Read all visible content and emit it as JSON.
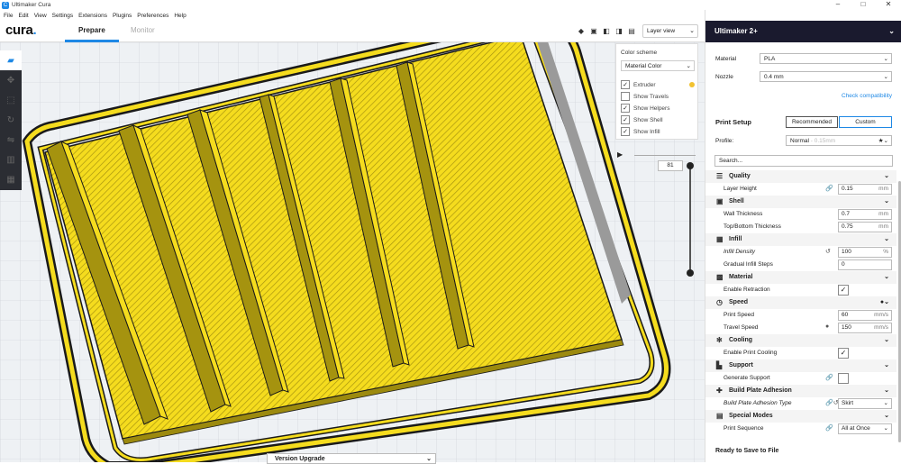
{
  "window": {
    "title": "Ultimaker Cura",
    "app_icon": "C",
    "controls": [
      "–",
      "□",
      "✕"
    ]
  },
  "menu": [
    "File",
    "Edit",
    "View",
    "Settings",
    "Extensions",
    "Plugins",
    "Preferences",
    "Help"
  ],
  "header": {
    "logo": "cura",
    "logo_dot": ".",
    "tabs": {
      "prepare": "Prepare",
      "monitor": "Monitor"
    },
    "view_mode": "Layer view",
    "view_icons": [
      "3d-view-icon",
      "front-view-icon",
      "top-view-icon",
      "left-view-icon",
      "right-view-icon"
    ]
  },
  "layer_panel": {
    "color_scheme_label": "Color scheme",
    "color_scheme_value": "Material Color",
    "options": [
      {
        "label": "Extruder",
        "checked": true
      },
      {
        "label": "Show Travels",
        "checked": false
      },
      {
        "label": "Show Helpers",
        "checked": true
      },
      {
        "label": "Show Shell",
        "checked": true
      },
      {
        "label": "Show Infill",
        "checked": true
      }
    ],
    "extruder_color": "#f2c230",
    "current_layer": "81"
  },
  "version_upgrade": {
    "label": "Version Upgrade"
  },
  "sidebar": {
    "printer": "Ultimaker 2+",
    "material_label": "Material",
    "material_value": "PLA",
    "nozzle_label": "Nozzle",
    "nozzle_value": "0.4 mm",
    "check_compat": "Check compatibility",
    "print_setup": "Print Setup",
    "recommended": "Recommended",
    "custom": "Custom",
    "profile_label": "Profile:",
    "profile_value": "Normal",
    "profile_suffix": " - 0.15mm",
    "search_placeholder": "Search...",
    "ready": "Ready to Save to File"
  },
  "settings": {
    "quality": {
      "label": "Quality",
      "layer_height_label": "Layer Height",
      "layer_height": "0.15",
      "layer_height_unit": "mm"
    },
    "shell": {
      "label": "Shell",
      "wall_label": "Wall Thickness",
      "wall": "0.7",
      "wall_unit": "mm",
      "tb_label": "Top/Bottom Thickness",
      "tb": "0.75",
      "tb_unit": "mm"
    },
    "infill": {
      "label": "Infill",
      "density_label": "Infill Density",
      "density": "100",
      "density_unit": "%",
      "gradual_label": "Gradual Infill Steps",
      "gradual": "0"
    },
    "material": {
      "label": "Material",
      "retraction_label": "Enable Retraction"
    },
    "speed": {
      "label": "Speed",
      "print_label": "Print Speed",
      "print": "60",
      "print_unit": "mm/s",
      "travel_label": "Travel Speed",
      "travel": "150",
      "travel_unit": "mm/s"
    },
    "cooling": {
      "label": "Cooling",
      "enable_label": "Enable Print Cooling"
    },
    "support": {
      "label": "Support",
      "generate_label": "Generate Support"
    },
    "adhesion": {
      "label": "Build Plate Adhesion",
      "type_label": "Build Plate Adhesion Type",
      "type": "Skirt"
    },
    "special": {
      "label": "Special Modes",
      "sequence_label": "Print Sequence",
      "sequence": "All at Once"
    }
  },
  "colors": {
    "filament": "#f5dc1e",
    "filament_dark": "#9c8a0e",
    "accent": "#1e88e5",
    "viewport_bg": "#eef1f4"
  }
}
